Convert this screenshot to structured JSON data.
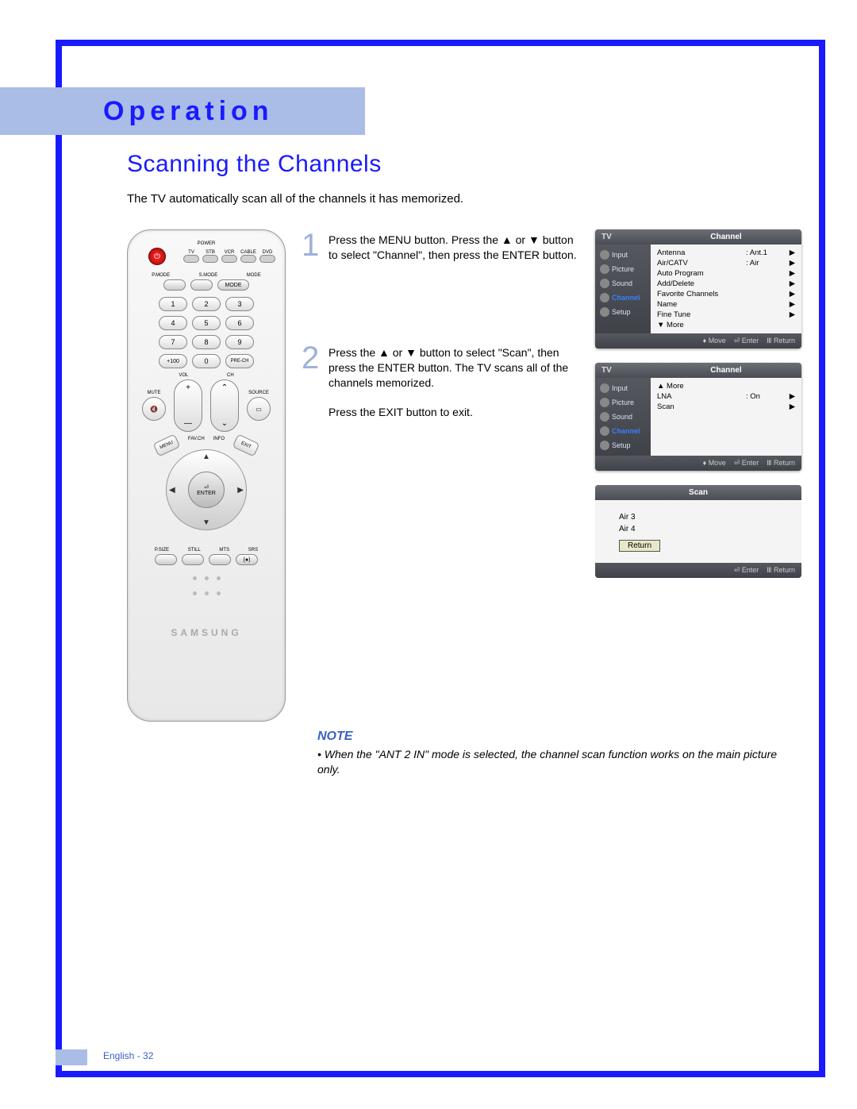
{
  "header": {
    "chapter": "Operation"
  },
  "section": {
    "title": "Scanning the Channels",
    "intro": "The TV automatically scan all of the channels it has memorized."
  },
  "remote": {
    "labels": {
      "power": "POWER",
      "modes": [
        "TV",
        "STB",
        "VCR",
        "CABLE",
        "DVD"
      ],
      "pmode": "P.MODE",
      "smode": "S.MODE",
      "mode": "MODE",
      "plus100": "+100",
      "prech": "PRE-CH",
      "vol": "VOL",
      "ch": "CH",
      "mute": "MUTE",
      "source": "SOURCE",
      "favch": "FAV.CH",
      "info": "INFO",
      "menu": "MENU",
      "exit": "EXIT",
      "enter": "ENTER",
      "psize": "P.SIZE",
      "still": "STILL",
      "mts": "MTS",
      "srs": "SRS"
    },
    "numbers": [
      "1",
      "2",
      "3",
      "4",
      "5",
      "6",
      "7",
      "8",
      "9",
      "0"
    ],
    "brand": "SAMSUNG"
  },
  "steps": [
    {
      "num": "1",
      "text": "Press the MENU button. Press the ▲ or ▼ button to select \"Channel\", then press the ENTER button."
    },
    {
      "num": "2",
      "text": "Press the ▲ or ▼ button to select \"Scan\", then press the ENTER button. The TV scans all of the channels memorized.\n\nPress the EXIT button to exit."
    }
  ],
  "osd": [
    {
      "tv": "TV",
      "title": "Channel",
      "side": [
        {
          "label": "Input",
          "sel": false
        },
        {
          "label": "Picture",
          "sel": false
        },
        {
          "label": "Sound",
          "sel": false
        },
        {
          "label": "Channel",
          "sel": true
        },
        {
          "label": "Setup",
          "sel": false
        }
      ],
      "items": [
        {
          "label": "Antenna",
          "value": ": Ant.1",
          "arrow": "▶"
        },
        {
          "label": "Air/CATV",
          "value": ": Air",
          "arrow": "▶"
        },
        {
          "label": "Auto Program",
          "value": "",
          "arrow": "▶"
        },
        {
          "label": "Add/Delete",
          "value": "",
          "arrow": "▶"
        },
        {
          "label": "Favorite Channels",
          "value": "",
          "arrow": "▶"
        },
        {
          "label": "Name",
          "value": "",
          "arrow": "▶"
        },
        {
          "label": "Fine Tune",
          "value": "",
          "arrow": "▶"
        },
        {
          "label": "▼ More",
          "value": "",
          "arrow": ""
        }
      ],
      "footer": [
        "Move",
        "Enter",
        "Return"
      ]
    },
    {
      "tv": "TV",
      "title": "Channel",
      "side": [
        {
          "label": "Input",
          "sel": false
        },
        {
          "label": "Picture",
          "sel": false
        },
        {
          "label": "Sound",
          "sel": false
        },
        {
          "label": "Channel",
          "sel": true
        },
        {
          "label": "Setup",
          "sel": false
        }
      ],
      "items": [
        {
          "label": "▲ More",
          "value": "",
          "arrow": ""
        },
        {
          "label": "LNA",
          "value": ": On",
          "arrow": "▶"
        },
        {
          "label": "Scan",
          "value": "",
          "arrow": "▶"
        }
      ],
      "footer": [
        "Move",
        "Enter",
        "Return"
      ]
    }
  ],
  "osd_scan": {
    "title": "Scan",
    "lines": [
      "Air 3",
      "Air 4"
    ],
    "return": "Return",
    "footer": [
      "Enter",
      "Return"
    ]
  },
  "note": {
    "heading": "NOTE",
    "body": "When the \"ANT 2 IN\" mode is selected, the channel scan function works on the main picture only."
  },
  "footer": {
    "lang": "English",
    "page": "32"
  }
}
